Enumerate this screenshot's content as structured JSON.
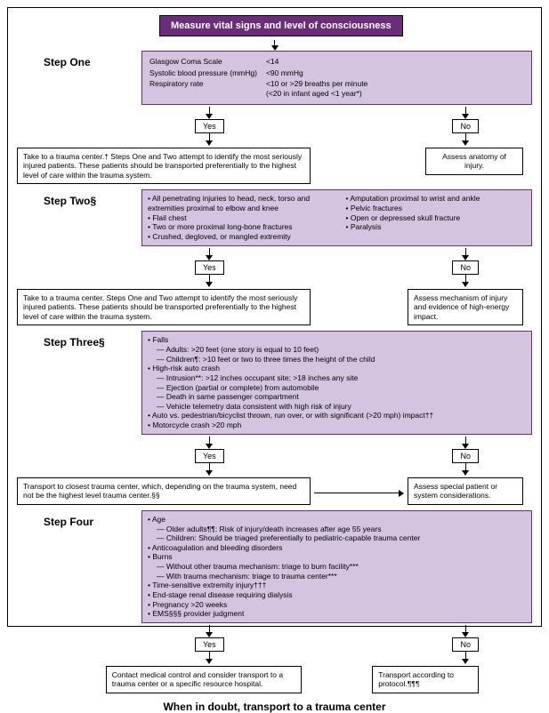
{
  "header": "Measure vital signs and level of consciousness",
  "step1": {
    "label": "Step One",
    "rows": [
      [
        "Glasgow Coma Scale",
        "<14"
      ],
      [
        "Systolic blood pressure (mmHg)",
        "<90 mmHg"
      ],
      [
        "Respiratory rate",
        "<10 or >29 breaths per minute\n(<20 in infant aged <1 year*)"
      ]
    ]
  },
  "yes": "Yes",
  "no": "No",
  "action1_left": "Take to a trauma center.† Steps One and Two attempt to identify the most seriously injured patients. These patients should be transported preferentially to the highest level of care within the trauma system.",
  "action1_right": "Assess anatomy of injury.",
  "step2": {
    "label": "Step Two§",
    "left": [
      "All penetrating injuries to head, neck, torso and extremities proximal to elbow and knee",
      "Flail chest",
      "Two or more proximal long-bone fractures",
      "Crushed, degloved, or mangled extremity"
    ],
    "right": [
      "Amputation proximal to wrist and ankle",
      "Pelvic fractures",
      "Open or depressed skull fracture",
      "Paralysis"
    ]
  },
  "action2_left": "Take to a trauma center. Steps One and Two attempt to identify the most seriously injured patients. These patients should be transported preferentially to the highest level of care within the trauma system.",
  "action2_right": "Assess mechanism of injury and evidence of high-energy impact.",
  "step3": {
    "label": "Step Three§",
    "items": [
      {
        "t": "Falls",
        "sub": [
          "Adults: >20 feet (one story is equal to 10 feet)",
          "Children¶: >10 feet or two to three times the height of the child"
        ]
      },
      {
        "t": "High-risk auto crash",
        "sub": [
          "Intrusion**: >12 inches occupant site; >18 inches any site",
          "Ejection (partial or complete) from automobile",
          "Death in same passenger compartment",
          "Vehicle telemetry data consistent with high risk of injury"
        ]
      },
      {
        "t": "Auto vs. pedestrian/bicyclist thrown, run over, or with significant (>20 mph) impact††"
      },
      {
        "t": "Motorcycle crash >20 mph"
      }
    ]
  },
  "action3_left": "Transport to closest trauma center, which, depending on the trauma system, need not be the highest level trauma center.§§",
  "action3_right": "Assess special patient or system considerations.",
  "step4": {
    "label": "Step Four",
    "items": [
      {
        "t": "Age",
        "sub": [
          "Older adults¶¶: Risk of injury/death increases after age 55 years",
          "Children: Should be triaged preferentially to pediatric-capable trauma center"
        ]
      },
      {
        "t": "Anticoagulation and bleeding disorders"
      },
      {
        "t": "Burns",
        "sub": [
          "Without other trauma mechanism: triage to burn facility***",
          "With trauma mechanism: triage to trauma center***"
        ]
      },
      {
        "t": "Time-sensitive extremity injury†††"
      },
      {
        "t": "End-stage renal disease requiring dialysis"
      },
      {
        "t": "Pregnancy >20 weeks"
      },
      {
        "t": "EMS§§§ provider judgment"
      }
    ]
  },
  "action4_left": "Contact medical control and consider transport to a trauma center or a specific resource hospital.",
  "action4_right": "Transport according to protocol.¶¶¶",
  "footer": "When in doubt, transport to a trauma center",
  "chart_data": {
    "type": "flowchart",
    "title": "Measure vital signs and level of consciousness",
    "nodes": [
      {
        "id": "start",
        "label": "Measure vital signs and level of consciousness"
      },
      {
        "id": "s1",
        "label": "Step One criteria (GCS <14, SBP <90 mmHg, RR <10 or >29 [<20 infant <1yr])"
      },
      {
        "id": "a1y",
        "label": "Take to trauma center (highest level)"
      },
      {
        "id": "a1n",
        "label": "Assess anatomy of injury"
      },
      {
        "id": "s2",
        "label": "Step Two anatomic criteria"
      },
      {
        "id": "a2y",
        "label": "Take to trauma center (highest level)"
      },
      {
        "id": "a2n",
        "label": "Assess mechanism / high-energy impact"
      },
      {
        "id": "s3",
        "label": "Step Three mechanism criteria"
      },
      {
        "id": "a3y",
        "label": "Transport to closest trauma center"
      },
      {
        "id": "a3n",
        "label": "Assess special patient/system considerations"
      },
      {
        "id": "s4",
        "label": "Step Four special considerations"
      },
      {
        "id": "a4y",
        "label": "Contact medical control / consider transport to trauma center or resource hospital"
      },
      {
        "id": "a4n",
        "label": "Transport according to protocol"
      },
      {
        "id": "footer",
        "label": "When in doubt, transport to a trauma center"
      }
    ],
    "edges": [
      [
        "start",
        "s1",
        ""
      ],
      [
        "s1",
        "a1y",
        "Yes"
      ],
      [
        "s1",
        "a1n",
        "No"
      ],
      [
        "a1n",
        "s2",
        ""
      ],
      [
        "s2",
        "a2y",
        "Yes"
      ],
      [
        "s2",
        "a2n",
        "No"
      ],
      [
        "a2n",
        "s3",
        ""
      ],
      [
        "s3",
        "a3y",
        "Yes"
      ],
      [
        "s3",
        "a3n",
        "No"
      ],
      [
        "a3y",
        "a3n",
        ""
      ],
      [
        "a3n",
        "s4",
        ""
      ],
      [
        "s4",
        "a4y",
        "Yes"
      ],
      [
        "s4",
        "a4n",
        "No"
      ]
    ]
  }
}
